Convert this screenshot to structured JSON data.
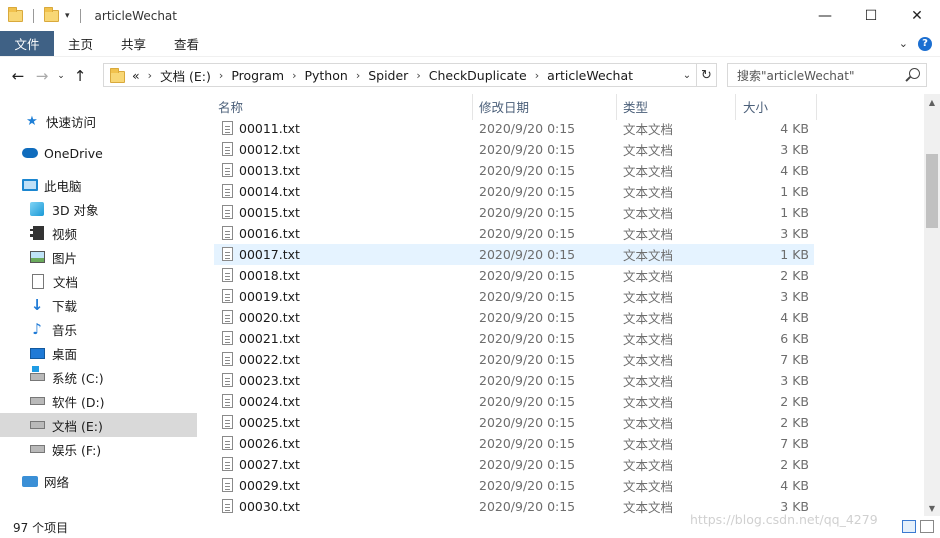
{
  "window": {
    "title": "articleWechat",
    "controls": {
      "minimize": "—",
      "maximize": "☐",
      "close": "✕"
    }
  },
  "ribbon": {
    "tabs": [
      "文件",
      "主页",
      "共享",
      "查看"
    ]
  },
  "address": {
    "overflow": "«",
    "crumbs": [
      "文档 (E:)",
      "Program",
      "Python",
      "Spider",
      "CheckDuplicate",
      "articleWechat"
    ]
  },
  "search": {
    "placeholder": "搜索\"articleWechat\""
  },
  "sidebar": {
    "quick_access": "快速访问",
    "onedrive": "OneDrive",
    "this_pc": "此电脑",
    "pc_items": [
      "3D 对象",
      "视频",
      "图片",
      "文档",
      "下载",
      "音乐",
      "桌面",
      "系统 (C:)",
      "软件 (D:)",
      "文档 (E:)",
      "娱乐 (F:)"
    ],
    "network": "网络",
    "selected": "文档 (E:)"
  },
  "columns": {
    "name": "名称",
    "date": "修改日期",
    "type": "类型",
    "size": "大小"
  },
  "files": [
    {
      "name": "00011.txt",
      "date": "2020/9/20 0:15",
      "type": "文本文档",
      "size": "4 KB"
    },
    {
      "name": "00012.txt",
      "date": "2020/9/20 0:15",
      "type": "文本文档",
      "size": "3 KB"
    },
    {
      "name": "00013.txt",
      "date": "2020/9/20 0:15",
      "type": "文本文档",
      "size": "4 KB"
    },
    {
      "name": "00014.txt",
      "date": "2020/9/20 0:15",
      "type": "文本文档",
      "size": "1 KB"
    },
    {
      "name": "00015.txt",
      "date": "2020/9/20 0:15",
      "type": "文本文档",
      "size": "1 KB"
    },
    {
      "name": "00016.txt",
      "date": "2020/9/20 0:15",
      "type": "文本文档",
      "size": "3 KB"
    },
    {
      "name": "00017.txt",
      "date": "2020/9/20 0:15",
      "type": "文本文档",
      "size": "1 KB"
    },
    {
      "name": "00018.txt",
      "date": "2020/9/20 0:15",
      "type": "文本文档",
      "size": "2 KB"
    },
    {
      "name": "00019.txt",
      "date": "2020/9/20 0:15",
      "type": "文本文档",
      "size": "3 KB"
    },
    {
      "name": "00020.txt",
      "date": "2020/9/20 0:15",
      "type": "文本文档",
      "size": "4 KB"
    },
    {
      "name": "00021.txt",
      "date": "2020/9/20 0:15",
      "type": "文本文档",
      "size": "6 KB"
    },
    {
      "name": "00022.txt",
      "date": "2020/9/20 0:15",
      "type": "文本文档",
      "size": "7 KB"
    },
    {
      "name": "00023.txt",
      "date": "2020/9/20 0:15",
      "type": "文本文档",
      "size": "3 KB"
    },
    {
      "name": "00024.txt",
      "date": "2020/9/20 0:15",
      "type": "文本文档",
      "size": "2 KB"
    },
    {
      "name": "00025.txt",
      "date": "2020/9/20 0:15",
      "type": "文本文档",
      "size": "2 KB"
    },
    {
      "name": "00026.txt",
      "date": "2020/9/20 0:15",
      "type": "文本文档",
      "size": "7 KB"
    },
    {
      "name": "00027.txt",
      "date": "2020/9/20 0:15",
      "type": "文本文档",
      "size": "2 KB"
    },
    {
      "name": "00029.txt",
      "date": "2020/9/20 0:15",
      "type": "文本文档",
      "size": "4 KB"
    },
    {
      "name": "00030.txt",
      "date": "2020/9/20 0:15",
      "type": "文本文档",
      "size": "3 KB"
    }
  ],
  "hovered_file": "00017.txt",
  "status": {
    "item_count": "97 个项目"
  },
  "watermark": "https://blog.csdn.net/qq_4279"
}
